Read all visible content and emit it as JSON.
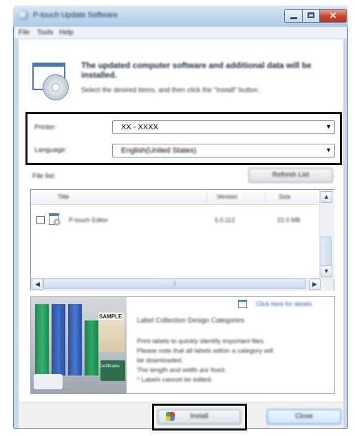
{
  "window": {
    "title": "P-touch Update Software",
    "controls": {
      "minimize": "minimize",
      "maximize": "maximize",
      "close_glyph": "✕"
    }
  },
  "menu": [
    "File",
    "Tools",
    "Help"
  ],
  "header": {
    "title": "The updated computer software and additional data will be installed.",
    "subtitle": "Select the desired items, and then click the \"Install\" button."
  },
  "printer": {
    "label": "Printer:",
    "value": "XX - XXXX"
  },
  "language": {
    "label": "Language:",
    "value": "English(United States)"
  },
  "file_list": {
    "label": "File list:",
    "refresh_button": "Refresh List",
    "columns": [
      "Title",
      "Version",
      "Size"
    ],
    "rows": [
      {
        "title": "P-touch Editor",
        "version": "5.0.112",
        "size": "22.0 MB",
        "checked": false
      }
    ],
    "hscroll_grip": "|||"
  },
  "info_panel": {
    "link": "Click here for details",
    "title": "Label Collection Design Categories",
    "lines": [
      "Print labels to quickly identify important files.",
      "Please note that all labels within a category will",
      "be downloaded.",
      "The length and width are fixed.",
      "* Labels cannot be edited."
    ],
    "photo_labels": [
      "SAMPLE",
      "Certificates"
    ]
  },
  "buttons": {
    "install": "Install",
    "close": "Close"
  },
  "colors": {
    "titlebar": "#bfd4ec",
    "close_button": "#c8452b",
    "link": "#2a58b4",
    "highlight_box": "#111111"
  },
  "icons": [
    "app-icon",
    "cd-disc-icon",
    "dropdown-arrow-icon",
    "scroll-up-icon",
    "scroll-down-icon",
    "scroll-left-icon",
    "scroll-right-icon",
    "document-cd-icon",
    "shield-icon"
  ]
}
